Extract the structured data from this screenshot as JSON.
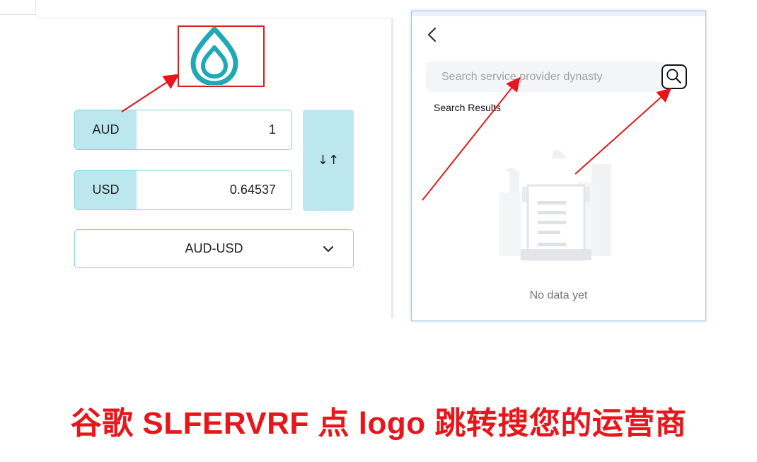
{
  "converter": {
    "from_currency": "AUD",
    "from_amount": "1",
    "to_currency": "USD",
    "to_amount": "0.64537",
    "swap_symbol": "↓↑",
    "pair": "AUD-USD"
  },
  "search_panel": {
    "placeholder": "Search service provider dynasty",
    "results_label": "Search Results",
    "empty_text": "No data yet"
  },
  "caption": "谷歌 SLFERVRF 点 logo 跳转搜您的运营商",
  "colors": {
    "accent_teal": "#20a9b4",
    "field_fill": "#bde7ee",
    "annotation_red": "#e8161a"
  }
}
